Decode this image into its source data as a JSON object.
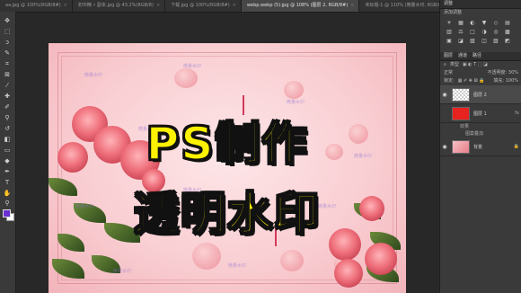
{
  "tabs": [
    {
      "label": "aa.jpg @ 100%(RGB/8#)",
      "active": false
    },
    {
      "label": "初中精 • 副本.jpg @ 43.2%(RGB/8)",
      "active": false
    },
    {
      "label": "下载.jpg @ 100%(RGB/8#)",
      "active": false
    },
    {
      "label": "webp.webp (5).jpg @ 108% (图层 2, RGB/8#)",
      "active": true
    },
    {
      "label": "未标题-1 @ 110% (微量水印, RGB/8)",
      "active": false
    }
  ],
  "canvas": {
    "line1": "PS制作",
    "line2": "透明水印",
    "watermark": "微量水印"
  },
  "panels": {
    "adjust_title": "调整",
    "adjust_sub": "添加调整",
    "adjust_icons": [
      "☀",
      "▦",
      "◐",
      "▼",
      "◇",
      "▤",
      "▥",
      "⚖",
      "□",
      "◑",
      "◎",
      "▩",
      "▣",
      "◪",
      "▧",
      "◫",
      "▨",
      "◩"
    ],
    "layers_tabs": [
      "图层",
      "通道",
      "路径"
    ],
    "kind_label": "类型",
    "blend_mode": "正常",
    "opacity_label": "不透明度: 30%",
    "lock_label": "锁定:",
    "fill_label": "填充: 100%",
    "layers": [
      {
        "name": "图层 2",
        "thumb": "checker"
      },
      {
        "name": "图层 1",
        "thumb": "red"
      },
      {
        "name": "背景",
        "thumb": "photo"
      }
    ],
    "effects_label": "效果",
    "effect_item": "图案叠加"
  }
}
